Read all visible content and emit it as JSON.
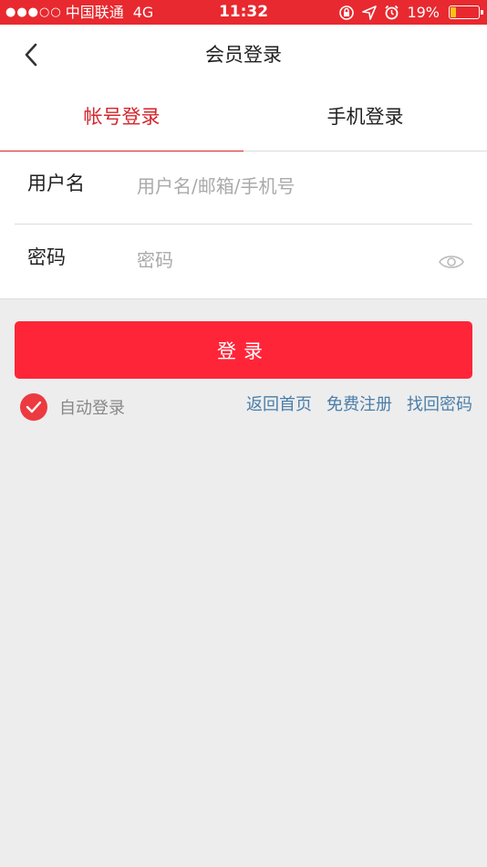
{
  "status_bar": {
    "signal": "●●●○○",
    "carrier": "中国联通",
    "network": "4G",
    "time": "11:32",
    "battery_percent": "19%",
    "battery_level": 0.19
  },
  "nav": {
    "title": "会员登录"
  },
  "tabs": [
    {
      "label": "帐号登录",
      "active": true
    },
    {
      "label": "手机登录",
      "active": false
    }
  ],
  "form": {
    "username_label": "用户名",
    "username_placeholder": "用户名/邮箱/手机号",
    "username_value": "",
    "password_label": "密码",
    "password_placeholder": "密码",
    "password_value": ""
  },
  "login_button": "登录",
  "auto_login": {
    "label": "自动登录",
    "checked": true
  },
  "links": [
    "返回首页",
    "免费注册",
    "找回密码"
  ],
  "colors": {
    "brand_red": "#e8292f",
    "button_red": "#ff2538",
    "link_blue": "#4a7eaa"
  }
}
